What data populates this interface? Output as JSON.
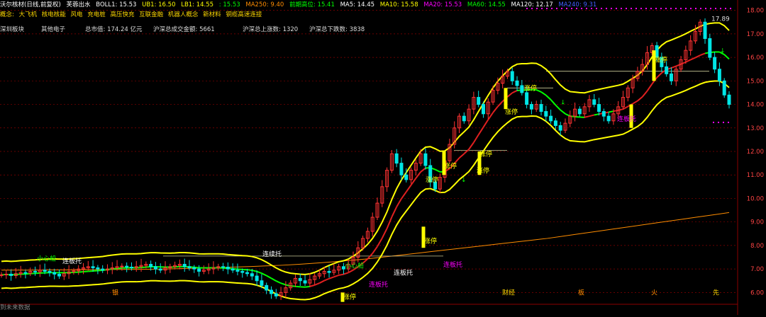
{
  "header": {
    "stock_name": "沃尔核材(日线,前复权)",
    "indicator_name": "芙蓉出水",
    "boll": "BOLL1: 15.53",
    "ub": "UB1: 16.50",
    "lb": "LB1: 14.55",
    "bias": ": 15.53",
    "ma250": "MA250: 9.40",
    "prev_high": "前期高位: 15.41",
    "ma5": "MA5: 14.45",
    "ma10": "MA10: 15.58",
    "ma20": "MA20: 15.53",
    "ma60": "MA60: 14.55",
    "ma120": "MA120: 12.17",
    "extra": "MA240: 9.31"
  },
  "concepts": {
    "prefix": "概念:",
    "items": [
      "大飞机",
      "核电核能",
      "风电",
      "充电桩",
      "高压快充",
      "互联金融",
      "机器人概念",
      "新材料",
      "铜缆高速连接"
    ]
  },
  "info": {
    "board": "深圳板块",
    "industry": "其他电子",
    "market_cap": "总市值: 174.24 亿元",
    "turnover": "沪深总成交金额: 5661",
    "up_count": "沪深总上涨数: 1320",
    "down_count": "沪深总下跌数: 3838"
  },
  "footer": {
    "text": "到未来数据"
  },
  "annotations": {
    "max_price": "17.89",
    "zhang_ting": "涨停",
    "xiao_xin_chuan": "小心船",
    "lian_ban_tuo": "连板托",
    "lian_ban_tuo2": "连续托",
    "cai_jing": "财经",
    "ban": "板",
    "huo": "火",
    "xian": "先",
    "yin": "银"
  },
  "chart_data": {
    "type": "candlestick",
    "ylim": [
      5.8,
      18.2
    ],
    "y_ticks": [
      6.0,
      7.0,
      8.0,
      9.0,
      10.0,
      11.0,
      12.0,
      13.0,
      14.0,
      15.0,
      16.0,
      17.0,
      18.0
    ],
    "y_tick_labels": [
      "6.00",
      "7.00",
      "8.00",
      "9.00",
      "10.00",
      "11.00",
      "12.00",
      "13.00",
      "14.00",
      "15.00",
      "16.00",
      "17.00",
      "18.00"
    ],
    "colors": {
      "up": "#ff3232",
      "down": "#00e5e5",
      "boll_bands": "#ffff00",
      "ma_mid": "#e02020",
      "ma_green": "#00ff00",
      "ma_long": "#ff8c00",
      "prev_high": "#cccc99",
      "limit_up": "#ffff00",
      "grid": "#8b0000"
    },
    "price_path": [
      6.75,
      6.78,
      6.72,
      6.8,
      6.85,
      6.82,
      6.9,
      6.88,
      6.95,
      6.9,
      6.85,
      6.78,
      6.7,
      6.8,
      6.88,
      6.92,
      7.0,
      7.05,
      7.1,
      7.05,
      7.0,
      6.95,
      7.0,
      7.05,
      7.1,
      7.12,
      7.08,
      7.05,
      7.1,
      7.15,
      7.2,
      7.1,
      7.0,
      6.95,
      7.05,
      7.1,
      7.15,
      7.2,
      7.1,
      7.05,
      7.0,
      6.9,
      6.95,
      7.0,
      7.05,
      7.1,
      7.08,
      7.0,
      6.95,
      6.9,
      6.85,
      6.8,
      6.7,
      6.5,
      6.3,
      6.1,
      5.95,
      5.85,
      6.0,
      6.2,
      6.4,
      6.6,
      6.5,
      6.4,
      6.55,
      6.7,
      6.8,
      6.9,
      6.85,
      6.95,
      7.1,
      7.0,
      7.2,
      7.5,
      7.9,
      8.3,
      8.6,
      9.2,
      9.8,
      10.5,
      11.2,
      11.9,
      11.5,
      11.0,
      10.8,
      11.2,
      11.5,
      11.9,
      11.4,
      10.7,
      10.4,
      10.9,
      11.6,
      12.3,
      13.0,
      13.5,
      13.3,
      13.8,
      14.3,
      14.0,
      13.6,
      14.1,
      14.6,
      14.9,
      15.2,
      15.4,
      15.0,
      14.8,
      14.5,
      14.0,
      13.8,
      14.0,
      13.7,
      13.5,
      13.3,
      13.1,
      12.9,
      13.2,
      13.5,
      13.8,
      13.6,
      13.9,
      14.2,
      14.0,
      13.7,
      13.5,
      13.3,
      13.6,
      13.9,
      14.3,
      14.7,
      15.1,
      15.4,
      15.7,
      16.2,
      16.5,
      16.0,
      15.6,
      15.3,
      15.0,
      15.5,
      15.9,
      16.3,
      16.7,
      17.1,
      17.5,
      16.8,
      16.0,
      15.5,
      15.0,
      14.4,
      14.0
    ],
    "ma_long_path": [
      6.95,
      6.95,
      6.95,
      6.96,
      6.96,
      6.97,
      6.97,
      6.98,
      6.98,
      6.99,
      7.0,
      7.02,
      7.04,
      7.06,
      7.08,
      7.1,
      7.13,
      7.16,
      7.2,
      7.25,
      7.3,
      7.36,
      7.42,
      7.5,
      7.58,
      7.66,
      7.74,
      7.82,
      7.9,
      7.98,
      8.06,
      8.14,
      8.22,
      8.3,
      8.4,
      8.5,
      8.6,
      8.7,
      8.8,
      8.9,
      9.0,
      9.1,
      9.2,
      9.3,
      9.4
    ],
    "limit_up_bars": [
      {
        "x": 483,
        "top": 6.0,
        "bottom": 5.6
      },
      {
        "x": 597,
        "top": 8.8,
        "bottom": 7.9
      },
      {
        "x": 626,
        "top": 12.0,
        "bottom": 11.0
      },
      {
        "x": 676,
        "top": 12.0,
        "bottom": 11.0
      },
      {
        "x": 713,
        "top": 14.7,
        "bottom": 13.8
      },
      {
        "x": 890,
        "top": 14.0,
        "bottom": 13.0
      },
      {
        "x": 922,
        "top": 16.3,
        "bottom": 15.0
      }
    ],
    "prev_high_lines": [
      {
        "x1": 230,
        "x2": 625,
        "y": 7.55
      },
      {
        "x1": 640,
        "x2": 715,
        "y": 12.05
      },
      {
        "x1": 715,
        "x2": 780,
        "y": 14.7
      },
      {
        "x1": 770,
        "x2": 1000,
        "y": 15.41
      }
    ]
  }
}
